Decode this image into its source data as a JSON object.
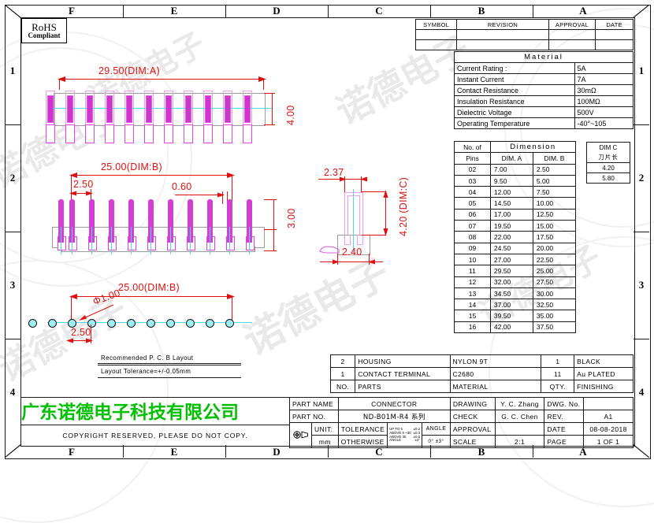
{
  "frame": {
    "zones_top": [
      "F",
      "E",
      "D",
      "C",
      "B",
      "A"
    ],
    "zones_bottom": [
      "F",
      "E",
      "D",
      "C",
      "B",
      "A"
    ],
    "rows_left": [
      "1",
      "2",
      "3",
      "4"
    ],
    "rows_right": [
      "1",
      "2",
      "3",
      "4"
    ]
  },
  "rohs": {
    "line1": "RoHS",
    "line2": "Compliant"
  },
  "revision_table": {
    "headers": [
      "SYMBOL",
      "REVISION",
      "APPROVAL",
      "DATE"
    ],
    "rows": [
      [
        "",
        "",
        "",
        ""
      ],
      [
        "",
        "",
        "",
        ""
      ]
    ]
  },
  "material_table": {
    "title": "Material",
    "rows": [
      [
        "Current Rating :",
        "5A"
      ],
      [
        "Instant Current",
        "7A"
      ],
      [
        "Contact Resistance",
        "30mΩ"
      ],
      [
        "Insulation Resistance",
        "100MΩ"
      ],
      [
        "Dielectric  Voltage",
        "500V"
      ],
      [
        "Operating Temperature",
        "-40°~105"
      ]
    ]
  },
  "dimension_table": {
    "col_pins_line1": "No. of",
    "col_pins_line2": "Pins",
    "group_header": "Dimension",
    "col_a": "DIM. A",
    "col_b": "DIM. B",
    "rows": [
      [
        "02",
        "7.00",
        "2.50"
      ],
      [
        "03",
        "9.50",
        "5.00"
      ],
      [
        "04",
        "12.00",
        "7.50"
      ],
      [
        "05",
        "14.50",
        "10.00"
      ],
      [
        "06",
        "17.00",
        "12.50"
      ],
      [
        "07",
        "19.50",
        "15.00"
      ],
      [
        "08",
        "22.00",
        "17.50"
      ],
      [
        "09",
        "24.50",
        "20.00"
      ],
      [
        "10",
        "27.00",
        "22.50"
      ],
      [
        "11",
        "29.50",
        "25.00"
      ],
      [
        "12",
        "32.00",
        "27.50"
      ],
      [
        "13",
        "34.50",
        "30.00"
      ],
      [
        "14",
        "37.00",
        "32.50"
      ],
      [
        "15",
        "39.50",
        "35.00"
      ],
      [
        "16",
        "42.00",
        "37.50"
      ]
    ]
  },
  "dimc_table": {
    "header": "DIM C",
    "subheader": "刀片长",
    "values": [
      "4.20",
      "5.80"
    ]
  },
  "parts_table": {
    "rows": [
      [
        "2",
        "HOUSING",
        "NYLON 9T",
        "1",
        "BLACK"
      ],
      [
        "1",
        "CONTACT  TERMINAL",
        "C2680",
        "11",
        "Au  PLATED"
      ],
      [
        "NO.",
        "PARTS",
        "MATERIAL",
        "QTY.",
        "FINISHING"
      ]
    ]
  },
  "title_block": {
    "part_name_label": "PART NAME",
    "part_name_value": "CONNECTOR",
    "part_no_label": "PART NO.",
    "part_no_value": "ND-B01M-R4 系列",
    "unit_label": "UNIT:",
    "unit_value": "mm",
    "tolerance_label": "TOLERANCE",
    "otherwise_label": "OTHERWISE",
    "tolerance_rows": [
      [
        "UP TO 5",
        "±0.2"
      ],
      [
        "ABOVE 5 ~30",
        "±0.3"
      ],
      [
        "ABOVE 30",
        "±0.5"
      ],
      [
        "ANGLE",
        "±3°"
      ]
    ],
    "angle_label": "ANGLE",
    "angle_value": "0°  ±3°",
    "drawing_label": "DRAWING",
    "drawing_value": "Y. C. Zhang",
    "check_label": "CHECK",
    "check_value": "G. C. Chen",
    "approval_label": "APPROVAL",
    "approval_value": "",
    "scale_label": "SCALE",
    "scale_value": "2:1",
    "dwg_no_label": "DWG. No.",
    "dwg_no_value": "",
    "rev_label": "REV.",
    "rev_value": "A1",
    "date_label": "DATE",
    "date_value": "08-08-2018",
    "page_label": "PAGE",
    "page_value": "1  OF  1"
  },
  "company": {
    "name": "广东诺德电子科技有限公司",
    "copyright": "COPYRIGHT RESERVED, PLEASE DO NOT COPY.",
    "name_color": "#00c000"
  },
  "views": {
    "top_view": {
      "dim_width": "29.50(DIM:A)",
      "dim_height": "4.00",
      "pin_count": 11
    },
    "front_view": {
      "dim_width": "25.00(DIM:B)",
      "dim_pitch": "2.50",
      "dim_pin_width": "0.60",
      "dim_height": "3.00",
      "pin_count": 11
    },
    "side_view": {
      "dim_left": "2.37",
      "dim_height": "4.20 (DIM:C)",
      "dim_bottom": "2.40"
    },
    "pcb_layout": {
      "dim_width": "25.00(DIM:B)",
      "dim_hole": "Φ1.00",
      "dim_pitch": "2.50",
      "caption": "Recommended P. C. B Layout",
      "tolerance": "Layout  Tolerance=+/-0.05mm",
      "hole_count": 11
    }
  },
  "watermark": {
    "text": "诺德电子"
  }
}
